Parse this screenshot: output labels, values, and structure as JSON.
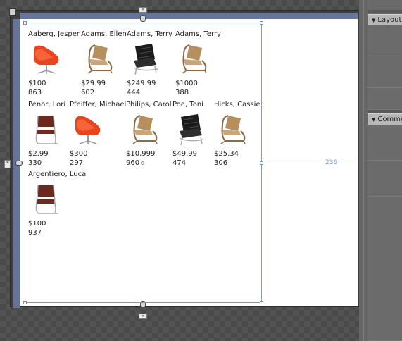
{
  "items": [
    {
      "name": "Aaberg, Jesper",
      "price": "$100",
      "quantity": "863",
      "chair": "egg-chair-icon"
    },
    {
      "name": "Adams, Ellen",
      "price": "$29.99",
      "quantity": "602",
      "chair": "bentwood-chair-icon"
    },
    {
      "name": "Adams, Terry",
      "price": "$249.99",
      "quantity": "444",
      "chair": "leather-chair-icon"
    },
    {
      "name": "Adams, Terry",
      "price": "$1000",
      "quantity": "388",
      "chair": "bentwood-chair-icon"
    },
    {
      "name": "Penor, Lori",
      "price": "$2.99",
      "quantity": "330",
      "chair": "cantilever-chair-icon"
    },
    {
      "name": "Pfeiffer, Michael",
      "price": "$300",
      "quantity": "297",
      "chair": "egg-chair-icon"
    },
    {
      "name": "Philips, Carol",
      "price": "$10,999",
      "quantity": "960",
      "chair": "bentwood-chair-icon"
    },
    {
      "name": "Poe, Toni",
      "price": "$49.99",
      "quantity": "474",
      "chair": "leather-chair-icon"
    },
    {
      "name": "Hicks, Cassie",
      "price": "$25.34",
      "quantity": "306",
      "chair": "bentwood-chair-icon"
    },
    {
      "name": "Argentiero, Luca",
      "price": "$100",
      "quantity": "937",
      "chair": "cantilever-chair-icon"
    }
  ],
  "margin_readout": "236",
  "top_anchor_label": "∞",
  "bottom_anchor_label": "∞",
  "left_anchor_label": "∞",
  "right_panel": {
    "sections": [
      {
        "title": "Layout"
      },
      {
        "title": "Common Properties"
      }
    ]
  },
  "colors": {
    "egg_chair": "#e8441e",
    "bentwood_chair": "#b58f5e",
    "leather_chair": "#1b1b1b",
    "cantilever_chair": "#6b2a1e"
  }
}
